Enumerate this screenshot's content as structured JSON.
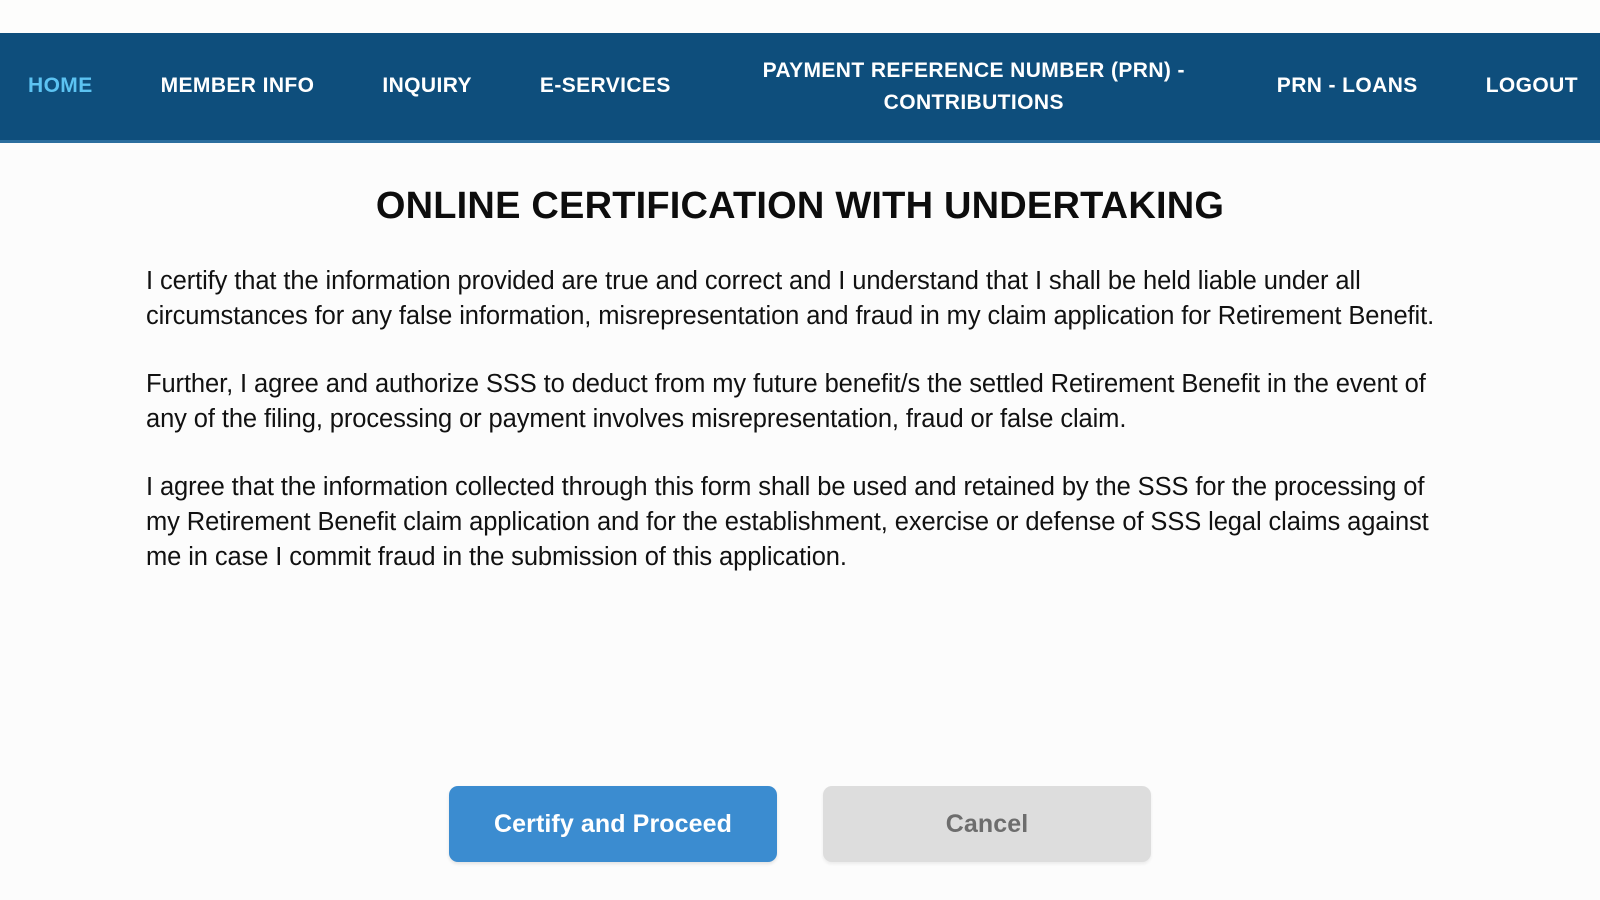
{
  "navbar": {
    "items": [
      {
        "label": "HOME",
        "active": true
      },
      {
        "label": "MEMBER INFO",
        "active": false
      },
      {
        "label": "INQUIRY",
        "active": false
      },
      {
        "label": "E-SERVICES",
        "active": false
      },
      {
        "label": "PAYMENT REFERENCE NUMBER (PRN) - CONTRIBUTIONS",
        "active": false
      },
      {
        "label": "PRN - LOANS",
        "active": false
      },
      {
        "label": "LOGOUT",
        "active": false
      }
    ],
    "background_color": "#0e4e7c",
    "active_color": "#5cc3f2",
    "text_color": "#ffffff"
  },
  "main": {
    "title": "ONLINE CERTIFICATION WITH UNDERTAKING",
    "paragraphs": [
      "I certify that the information provided are true and correct and I understand that I shall be held liable under all circumstances for any false information, misrepresentation and fraud in my claim application for Retirement Benefit.",
      "Further, I agree and authorize SSS to deduct from my future benefit/s the settled Retirement Benefit in the event of any of the filing, processing or payment involves misrepresentation, fraud or false claim.",
      "I agree that the information collected through this form shall be used and retained by the SSS for the processing of my Retirement Benefit claim application and for the establishment, exercise or defense of SSS legal claims against me in case I commit fraud in the submission of this application."
    ]
  },
  "actions": {
    "primary_label": "Certify and Proceed",
    "secondary_label": "Cancel",
    "primary_color": "#3b8cd0",
    "secondary_color": "#dddddd"
  }
}
